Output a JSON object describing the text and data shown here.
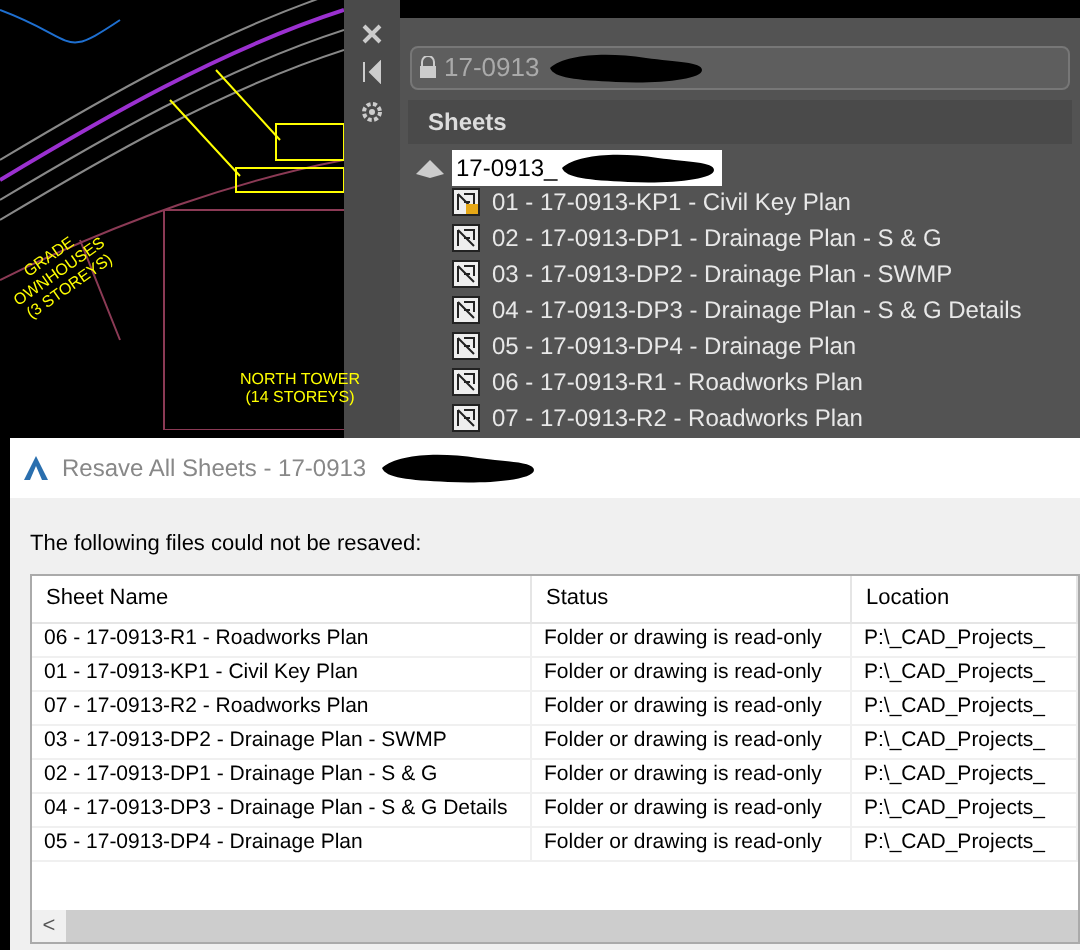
{
  "cad_labels": {
    "tower": [
      "NORTH TOWER",
      "(14 STOREYS)"
    ],
    "townhouses": [
      "GRADE",
      "OWNHOUSES",
      "(3 STOREYS)"
    ]
  },
  "sheet_set_manager": {
    "title": "17-0913",
    "header": "Sheets",
    "root": "17-0913_",
    "items": [
      {
        "label": "01 - 17-0913-KP1 - Civil Key Plan",
        "locked": true
      },
      {
        "label": "02 - 17-0913-DP1 - Drainage Plan - S & G",
        "locked": false
      },
      {
        "label": "03 - 17-0913-DP2 - Drainage Plan - SWMP",
        "locked": false
      },
      {
        "label": "04 - 17-0913-DP3 - Drainage Plan - S & G Details",
        "locked": false
      },
      {
        "label": "05 - 17-0913-DP4 - Drainage Plan",
        "locked": false
      },
      {
        "label": "06 - 17-0913-R1 - Roadworks Plan",
        "locked": false
      },
      {
        "label": "07 - 17-0913-R2 - Roadworks Plan",
        "locked": false
      }
    ]
  },
  "dialog": {
    "title": "Resave All Sheets - 17-0913",
    "message": "The following files could not be resaved:",
    "table": {
      "columns": [
        "Sheet Name",
        "Status",
        "Location"
      ],
      "rows": [
        [
          "06 - 17-0913-R1 - Roadworks Plan",
          "Folder or drawing is read-only",
          "P:\\_CAD_Projects_"
        ],
        [
          "01 - 17-0913-KP1 - Civil Key Plan",
          "Folder or drawing is read-only",
          "P:\\_CAD_Projects_"
        ],
        [
          "07 - 17-0913-R2 - Roadworks Plan",
          "Folder or drawing is read-only",
          "P:\\_CAD_Projects_"
        ],
        [
          "03 - 17-0913-DP2 - Drainage Plan - SWMP",
          "Folder or drawing is read-only",
          "P:\\_CAD_Projects_"
        ],
        [
          "02 - 17-0913-DP1 - Drainage Plan - S & G",
          "Folder or drawing is read-only",
          "P:\\_CAD_Projects_"
        ],
        [
          "04 - 17-0913-DP3 - Drainage Plan - S & G Details",
          "Folder or drawing is read-only",
          "P:\\_CAD_Projects_"
        ],
        [
          "05 - 17-0913-DP4 - Drainage Plan",
          "Folder or drawing is read-only",
          "P:\\_CAD_Projects_"
        ]
      ]
    },
    "scroll_arrow": "<"
  }
}
